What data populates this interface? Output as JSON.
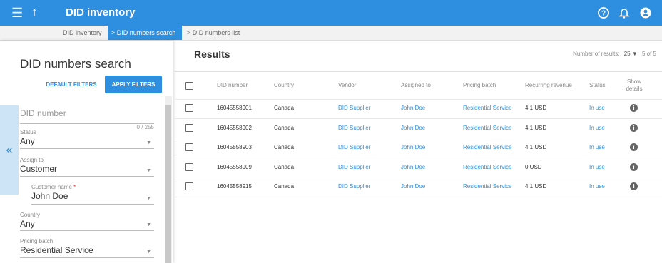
{
  "header": {
    "title": "DID inventory",
    "menu_icon": "menu-icon",
    "up_icon": "arrow-up-icon",
    "help_icon": "help-icon",
    "bell_icon": "bell-icon",
    "account_icon": "account-icon"
  },
  "breadcrumb": [
    "DID inventory",
    "DID numbers search",
    "DID numbers list"
  ],
  "sidebar": {
    "title": "DID numbers search",
    "default_filters": "DEFAULT FILTERS",
    "apply_filters": "APPLY FILTERS",
    "fields": {
      "did_number": {
        "placeholder": "DID number",
        "counter": "0 / 255"
      },
      "status": {
        "label": "Status",
        "value": "Any"
      },
      "assign_to": {
        "label": "Assign to",
        "value": "Customer"
      },
      "customer_name": {
        "label": "Customer name",
        "required_mark": "*",
        "value": "John Doe"
      },
      "country": {
        "label": "Country",
        "value": "Any"
      },
      "pricing_batch": {
        "label": "Pricing batch",
        "value": "Residential Service"
      }
    }
  },
  "results": {
    "title": "Results",
    "number_of_results_label": "Number of results:",
    "per_page": "25",
    "count": "5 of 5",
    "columns": [
      "DID number",
      "Country",
      "Vendor",
      "Assigned to",
      "Pricing batch",
      "Recurring revenue",
      "Status",
      "Show details"
    ],
    "rows": [
      [
        "16045558901",
        "Canada",
        "DID Supplier",
        "John Doe",
        "Residential Service",
        "4.1 USD",
        "In use"
      ],
      [
        "16045558902",
        "Canada",
        "DID Supplier",
        "John Doe",
        "Residential Service",
        "4.1 USD",
        "In use"
      ],
      [
        "16045558903",
        "Canada",
        "DID Supplier",
        "John Doe",
        "Residential Service",
        "4.1 USD",
        "In use"
      ],
      [
        "16045558909",
        "Canada",
        "DID Supplier",
        "John Doe",
        "Residential Service",
        "0 USD",
        "In use"
      ],
      [
        "16045558915",
        "Canada",
        "DID Supplier",
        "John Doe",
        "Residential Service",
        "4.1 USD",
        "In use"
      ]
    ]
  },
  "colors": {
    "accent": "#2e8fe0",
    "breadcrumb_active": "#2e8fe0",
    "collapse_bg": "#cde4f7"
  }
}
